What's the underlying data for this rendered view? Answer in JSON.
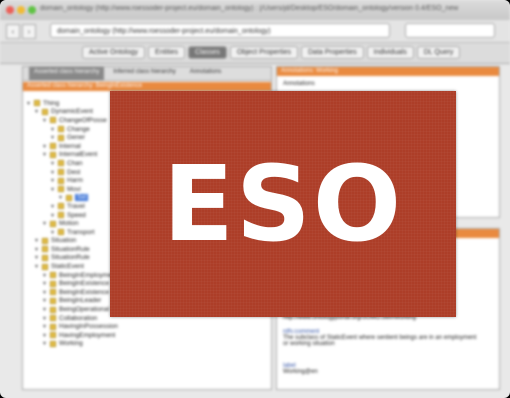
{
  "window": {
    "title": "domain_ontology (http://www.roessoder-project.eu/domain_ontology) : [/Users/jd/Desktop/ESO/domain_ontology/version 0.4/ESO_new"
  },
  "address_bar": {
    "url": "domain_ontology (http://www.roessoder-project.eu/domain_ontology)"
  },
  "tabs": [
    "Active Ontology",
    "Entities",
    "Classes",
    "Object Properties",
    "Data Properties",
    "Individuals",
    "DL Query"
  ],
  "active_tab": "Classes",
  "left_panel": {
    "subtabs": [
      "Asserted class hierarchy",
      "Inferred class hierarchy",
      "Annotations"
    ],
    "header": "Asserted class hierarchy: BeingInExistence",
    "tree": [
      {
        "label": "Thing",
        "depth": 0
      },
      {
        "label": "DynamicEvent",
        "depth": 1
      },
      {
        "label": "ChangeOfPosse",
        "depth": 2
      },
      {
        "label": "Change",
        "depth": 3
      },
      {
        "label": "Gener",
        "depth": 3
      },
      {
        "label": "Internal",
        "depth": 2
      },
      {
        "label": "InternalEvent",
        "depth": 2
      },
      {
        "label": "Chan",
        "depth": 3
      },
      {
        "label": "Dest",
        "depth": 3
      },
      {
        "label": "Harm",
        "depth": 3
      },
      {
        "label": "Movi",
        "depth": 3
      },
      {
        "label": "Sel",
        "depth": 4
      },
      {
        "label": "Travel",
        "depth": 3
      },
      {
        "label": "Speed",
        "depth": 3
      },
      {
        "label": "Motion",
        "depth": 2
      },
      {
        "label": "Transport",
        "depth": 3
      },
      {
        "label": "Situation",
        "depth": 1
      },
      {
        "label": "SituationRule",
        "depth": 1
      },
      {
        "label": "SituationRule",
        "depth": 1
      },
      {
        "label": "StaticEvent",
        "depth": 1
      },
      {
        "label": "BeingInEmployment",
        "depth": 2
      },
      {
        "label": "BeingInExistence",
        "depth": 2
      },
      {
        "label": "BeingInExistence",
        "depth": 2
      },
      {
        "label": "BeingInLeader",
        "depth": 2
      },
      {
        "label": "BeingOperational",
        "depth": 2
      },
      {
        "label": "Collaboration",
        "depth": 2
      },
      {
        "label": "HavingInPossession",
        "depth": 2
      },
      {
        "label": "HavingEmployment",
        "depth": 2
      },
      {
        "label": "Working",
        "depth": 2
      }
    ],
    "selected_index": 11
  },
  "right_top": {
    "header": "Annotations: Working",
    "field": "Annotations"
  },
  "right_bottom": {
    "header": "Annotations",
    "entries": [
      {
        "key": "rdfs:isDefinedBy",
        "value": "http://www.ontologyportal.org/SUMO.owl#Working"
      },
      {
        "key": "rdfs:comment",
        "value": "The subclass of StaticEvent where sentient beings are in an employment or working situation"
      },
      {
        "key": "label",
        "value": "Working@en"
      }
    ]
  },
  "overlay": {
    "logo_text": "ESO",
    "color": "#ad3e28"
  }
}
